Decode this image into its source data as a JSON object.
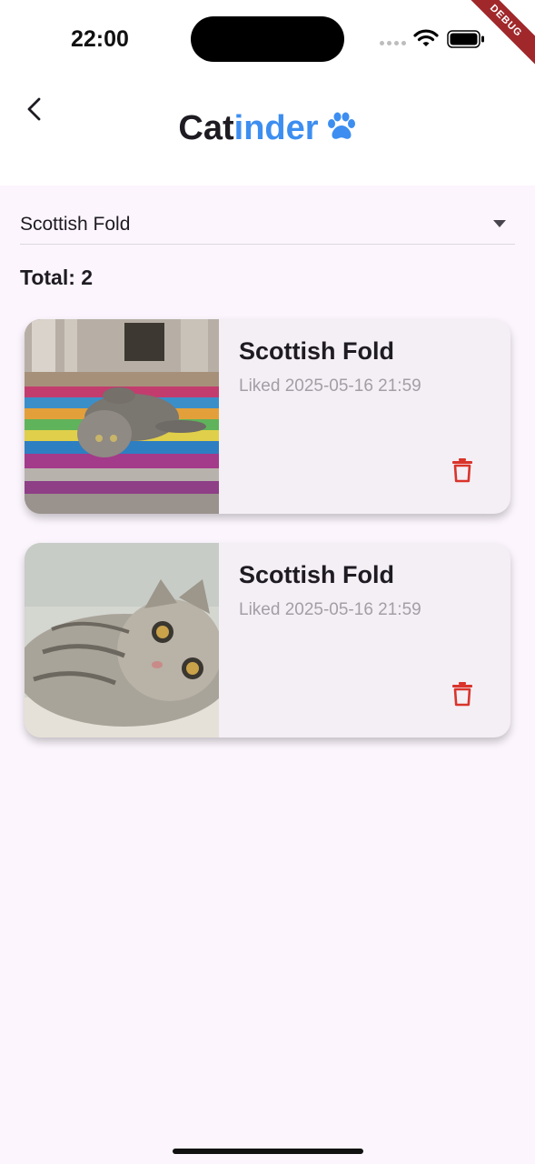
{
  "status_bar": {
    "time": "22:00",
    "debug_label": "DEBUG"
  },
  "app_bar": {
    "title_prefix": "Cat",
    "title_accent": "inder",
    "accent_color": "#3D8EF0",
    "icons": [
      "back-chevron-icon",
      "paw-icon"
    ]
  },
  "filter": {
    "selected": "Scottish Fold"
  },
  "summary": {
    "total_label": "Total: 2"
  },
  "cards": [
    {
      "breed": "Scottish Fold",
      "liked": "Liked 2025-05-16 21:59",
      "delete_icon": "trash-icon",
      "photo": "cat lying on striped rug"
    },
    {
      "breed": "Scottish Fold",
      "liked": "Liked 2025-05-16 21:59",
      "delete_icon": "trash-icon",
      "photo": "cat lying on side looking at camera"
    }
  ],
  "colors": {
    "delete": "#D9342B",
    "background": "#FCF5FD",
    "card": "#F4EFF5"
  }
}
